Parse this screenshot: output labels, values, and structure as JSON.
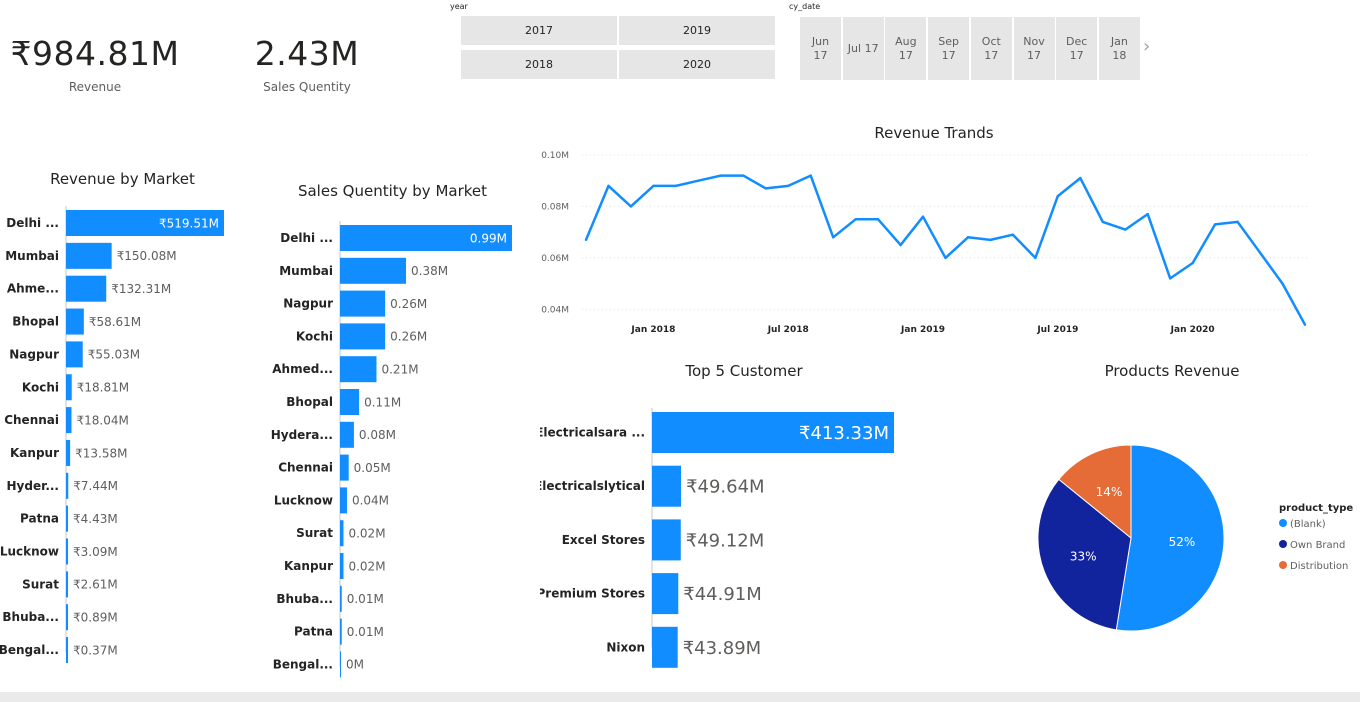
{
  "kpis": {
    "revenue": {
      "value": "₹984.81M",
      "label": "Revenue"
    },
    "sales_qty": {
      "value": "2.43M",
      "label": "Sales Quentity"
    }
  },
  "year_slicer": {
    "title": "year",
    "options": [
      "2017",
      "2019",
      "2018",
      "2020"
    ]
  },
  "date_slicer": {
    "title": "cy_date",
    "tiles": [
      "Jun\n17",
      "Jul 17",
      "Aug\n17",
      "Sep\n17",
      "Oct\n17",
      "Nov\n17",
      "Dec\n17",
      "Jan\n18"
    ],
    "next_icon": "chevron-right"
  },
  "colors": {
    "bar": "#118dff",
    "dark_blue": "#12239e",
    "orange": "#e66c37",
    "grid": "#e1e1e1",
    "axis_text": "#605e5c"
  },
  "chart_data": [
    {
      "id": "revenue_by_market",
      "type": "bar",
      "orientation": "horizontal",
      "title": "Revenue by Market",
      "categories": [
        "Delhi ...",
        "Mumbai",
        "Ahme...",
        "Bhopal",
        "Nagpur",
        "Kochi",
        "Chennai",
        "Kanpur",
        "Hyder...",
        "Patna",
        "Lucknow",
        "Surat",
        "Bhuba...",
        "Bengal..."
      ],
      "values": [
        519.51,
        150.08,
        132.31,
        58.61,
        55.03,
        18.81,
        18.04,
        13.58,
        7.44,
        4.43,
        3.09,
        2.61,
        0.89,
        0.37
      ],
      "labels": [
        "₹519.51M",
        "₹150.08M",
        "₹132.31M",
        "₹58.61M",
        "₹55.03M",
        "₹18.81M",
        "₹18.04M",
        "₹13.58M",
        "₹7.44M",
        "₹4.43M",
        "₹3.09M",
        "₹2.61M",
        "₹0.89M",
        "₹0.37M"
      ]
    },
    {
      "id": "sales_qty_by_market",
      "type": "bar",
      "orientation": "horizontal",
      "title": "Sales Quentity by Market",
      "categories": [
        "Delhi ...",
        "Mumbai",
        "Nagpur",
        "Kochi",
        "Ahmed...",
        "Bhopal",
        "Hydera...",
        "Chennai",
        "Lucknow",
        "Surat",
        "Kanpur",
        "Bhuba...",
        "Patna",
        "Bengal..."
      ],
      "values": [
        0.99,
        0.38,
        0.26,
        0.26,
        0.21,
        0.11,
        0.08,
        0.05,
        0.04,
        0.02,
        0.02,
        0.01,
        0.01,
        0
      ],
      "labels": [
        "0.99M",
        "0.38M",
        "0.26M",
        "0.26M",
        "0.21M",
        "0.11M",
        "0.08M",
        "0.05M",
        "0.04M",
        "0.02M",
        "0.02M",
        "0.01M",
        "0.01M",
        "0M"
      ]
    },
    {
      "id": "revenue_trends",
      "type": "line",
      "title": "Revenue Trands",
      "x_start": "2017-10",
      "x": [
        "2017-10",
        "2017-11",
        "2017-12",
        "2018-01",
        "2018-02",
        "2018-03",
        "2018-04",
        "2018-05",
        "2018-06",
        "2018-07",
        "2018-08",
        "2018-09",
        "2018-10",
        "2018-11",
        "2018-12",
        "2019-01",
        "2019-02",
        "2019-03",
        "2019-04",
        "2019-05",
        "2019-06",
        "2019-07",
        "2019-08",
        "2019-09",
        "2019-10",
        "2019-11",
        "2019-12",
        "2020-01",
        "2020-02",
        "2020-03",
        "2020-04",
        "2020-05",
        "2020-06"
      ],
      "y": [
        0.067,
        0.088,
        0.08,
        0.088,
        0.088,
        0.09,
        0.092,
        0.092,
        0.087,
        0.088,
        0.092,
        0.068,
        0.075,
        0.075,
        0.065,
        0.076,
        0.06,
        0.068,
        0.067,
        0.069,
        0.06,
        0.084,
        0.091,
        0.074,
        0.071,
        0.077,
        0.052,
        0.058,
        0.073,
        0.074,
        0.062,
        0.05,
        0.034
      ],
      "yticks": [
        0.04,
        0.06,
        0.08,
        0.1
      ],
      "ytick_labels": [
        "0.04M",
        "0.06M",
        "0.08M",
        "0.10M"
      ],
      "xticks": [
        "2018-01",
        "2018-07",
        "2019-01",
        "2019-07",
        "2020-01"
      ],
      "xtick_labels": [
        "Jan 2018",
        "Jul 2018",
        "Jan 2019",
        "Jul 2019",
        "Jan 2020"
      ],
      "ylim": [
        0.03,
        0.1
      ],
      "grid": true
    },
    {
      "id": "top5_customer",
      "type": "bar",
      "orientation": "horizontal",
      "title": "Top 5 Customer",
      "categories": [
        "Electricalsara ...",
        "Electricalslytical",
        "Excel Stores",
        "Premium Stores",
        "Nixon"
      ],
      "values": [
        413.33,
        49.64,
        49.12,
        44.91,
        43.89
      ],
      "labels": [
        "₹413.33M",
        "₹49.64M",
        "₹49.12M",
        "₹44.91M",
        "₹43.89M"
      ]
    },
    {
      "id": "products_revenue",
      "type": "pie",
      "title": "Products Revenue",
      "legend_title": "product_type",
      "categories": [
        "(Blank)",
        "Own Brand",
        "Distribution"
      ],
      "values": [
        52,
        33,
        14
      ],
      "labels": [
        "52%",
        "33%",
        "14%"
      ],
      "colors": [
        "#118dff",
        "#12239e",
        "#e66c37"
      ],
      "legend_position": "right"
    }
  ]
}
